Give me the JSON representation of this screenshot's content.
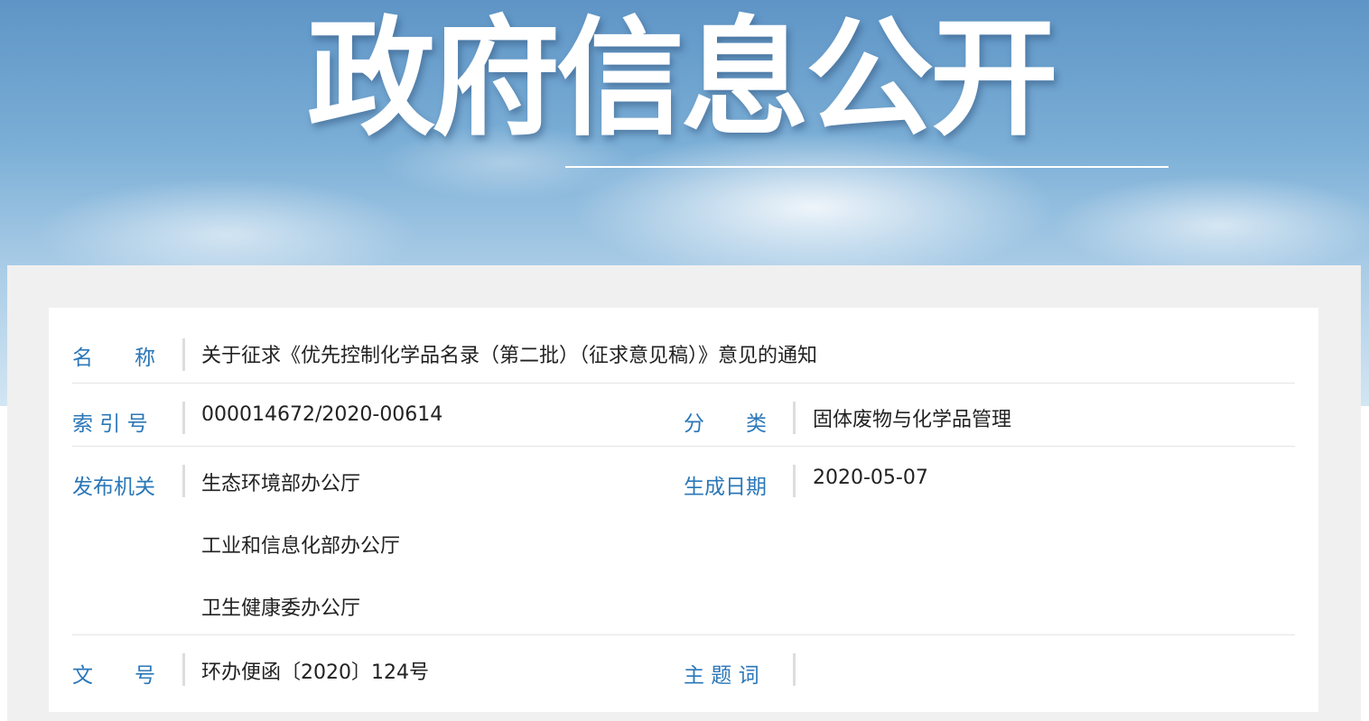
{
  "banner": {
    "title": "政府信息公开"
  },
  "info": {
    "name_label": "名　　称",
    "name_value": "关于征求《优先控制化学品名录（第二批）（征求意见稿）》意见的通知",
    "index_label": "索 引 号",
    "index_value": "000014672/2020-00614",
    "category_label": "分　　类",
    "category_value": "固体废物与化学品管理",
    "publisher_label": "发布机关",
    "publishers": [
      "生态环境部办公厅",
      "工业和信息化部办公厅",
      "卫生健康委办公厅"
    ],
    "date_label": "生成日期",
    "date_value": "2020-05-07",
    "docno_label": "文　　号",
    "docno_value": "环办便函〔2020〕124号",
    "keywords_label": "主 题 词",
    "keywords_value": ""
  }
}
